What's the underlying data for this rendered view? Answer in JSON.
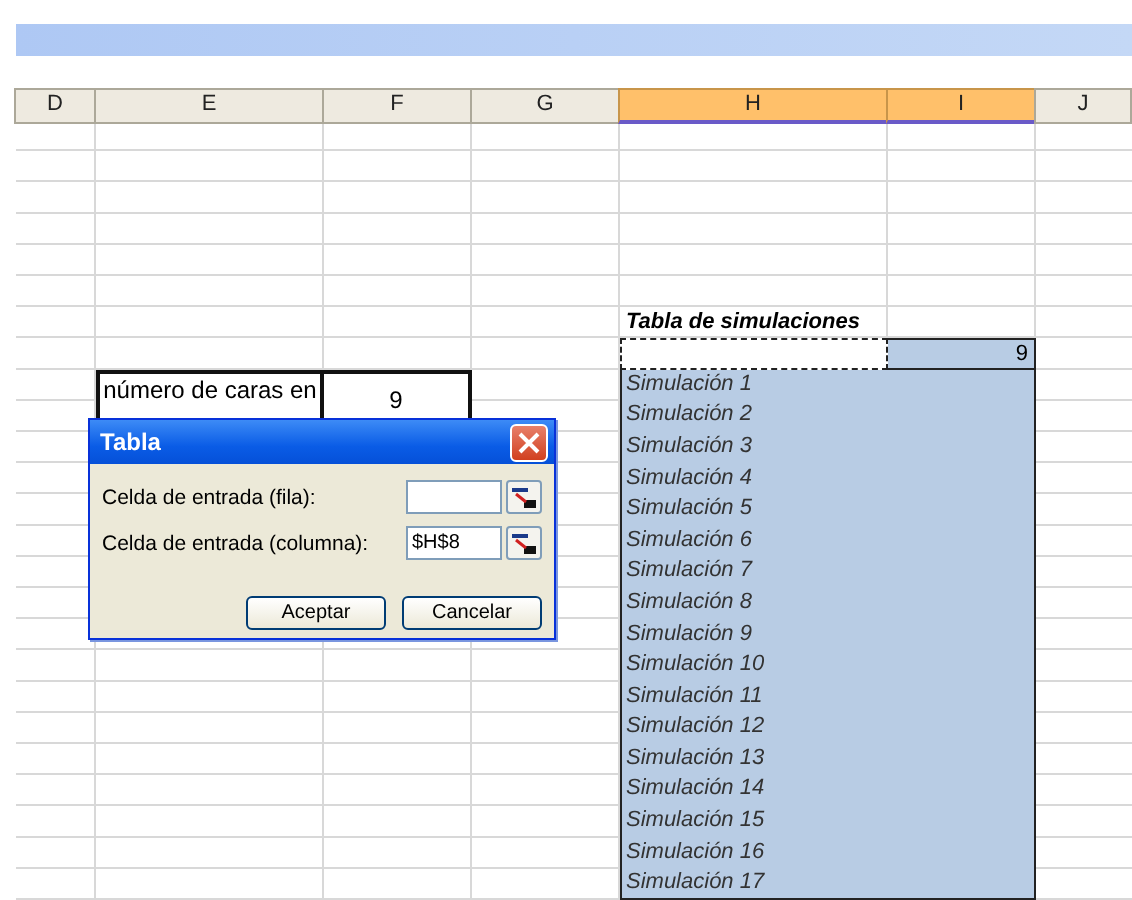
{
  "columns": [
    {
      "label": "D",
      "selected": false
    },
    {
      "label": "E",
      "selected": false
    },
    {
      "label": "F",
      "selected": false
    },
    {
      "label": "G",
      "selected": false
    },
    {
      "label": "H",
      "selected": true
    },
    {
      "label": "I",
      "selected": true
    },
    {
      "label": "J",
      "selected": false
    }
  ],
  "input_box": {
    "label": "número de caras en",
    "value": "9"
  },
  "table": {
    "title": "Tabla de simulaciones",
    "header_value": "9",
    "rows": [
      "Simulación 1",
      "Simulación 2",
      "Simulación 3",
      "Simulación 4",
      "Simulación 5",
      "Simulación 6",
      "Simulación 7",
      "Simulación 8",
      "Simulación 9",
      "Simulación 10",
      "Simulación 11",
      "Simulación 12",
      "Simulación 13",
      "Simulación 14",
      "Simulación 15",
      "Simulación 16",
      "Simulación 17"
    ]
  },
  "dialog": {
    "title": "Tabla",
    "fields": [
      {
        "label": "Celda de entrada (fila):"
      },
      {
        "label": "Celda de entrada (columna):",
        "value": "$H$8"
      }
    ],
    "buttons": [
      "Aceptar",
      "Cancelar"
    ]
  }
}
